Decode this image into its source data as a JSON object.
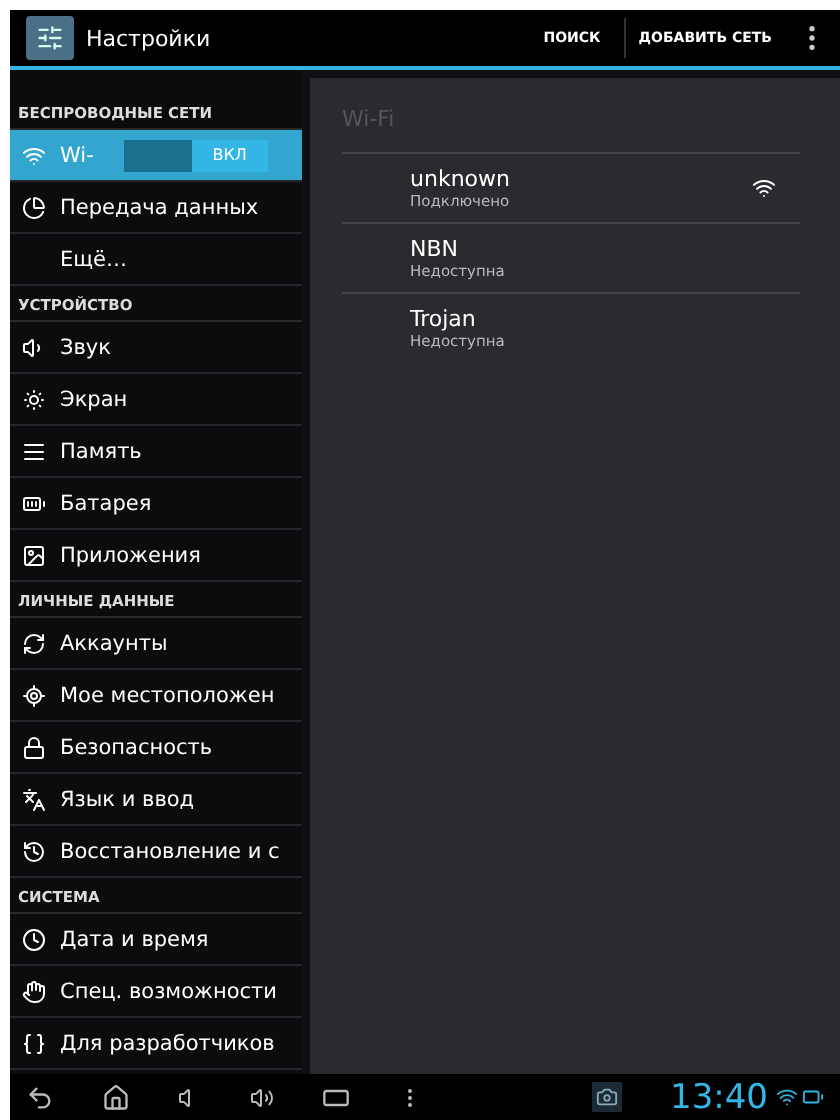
{
  "action_bar": {
    "title": "Настройки",
    "actions": [
      "ПОИСК",
      "ДОБАВИТЬ СЕТЬ"
    ]
  },
  "sidebar": {
    "sections": [
      {
        "header": "БЕСПРОВОДНЫЕ СЕТИ",
        "items": [
          {
            "label": "Wi-",
            "kind": "toggle",
            "selected": true,
            "toggle": {
              "on": true,
              "label": "ВКЛ"
            }
          },
          {
            "label": "Передача данных",
            "kind": "plain",
            "selected": false
          },
          {
            "label": "Ещё…",
            "kind": "plain",
            "selected": false
          }
        ]
      },
      {
        "header": "УСТРОЙСТВО",
        "items": [
          {
            "label": "Звук",
            "kind": "plain",
            "selected": false
          },
          {
            "label": "Экран",
            "kind": "plain",
            "selected": false
          },
          {
            "label": "Память",
            "kind": "plain",
            "selected": false
          },
          {
            "label": "Батарея",
            "kind": "plain",
            "selected": false
          },
          {
            "label": "Приложения",
            "kind": "plain",
            "selected": false
          }
        ]
      },
      {
        "header": "ЛИЧНЫЕ ДАННЫЕ",
        "items": [
          {
            "label": "Аккаунты",
            "kind": "plain",
            "selected": false
          },
          {
            "label": "Мое местоположен",
            "kind": "plain",
            "selected": false
          },
          {
            "label": "Безопасность",
            "kind": "plain",
            "selected": false
          },
          {
            "label": "Язык и ввод",
            "kind": "plain",
            "selected": false
          },
          {
            "label": "Восстановление и с",
            "kind": "plain",
            "selected": false
          }
        ]
      },
      {
        "header": "СИСТЕМА",
        "items": [
          {
            "label": "Дата и время",
            "kind": "plain",
            "selected": false
          },
          {
            "label": "Спец. возможности",
            "kind": "plain",
            "selected": false
          },
          {
            "label": "Для разработчиков",
            "kind": "plain",
            "selected": false
          }
        ]
      }
    ]
  },
  "panel": {
    "title": "Wi-Fi",
    "networks": [
      {
        "name": "unknown",
        "status": "Подключено",
        "connected": true
      },
      {
        "name": "NBN",
        "status": "Недоступна",
        "connected": false
      },
      {
        "name": "Trojan",
        "status": "Недоступна",
        "connected": false
      }
    ]
  },
  "status_bar": {
    "time": "13:40"
  }
}
